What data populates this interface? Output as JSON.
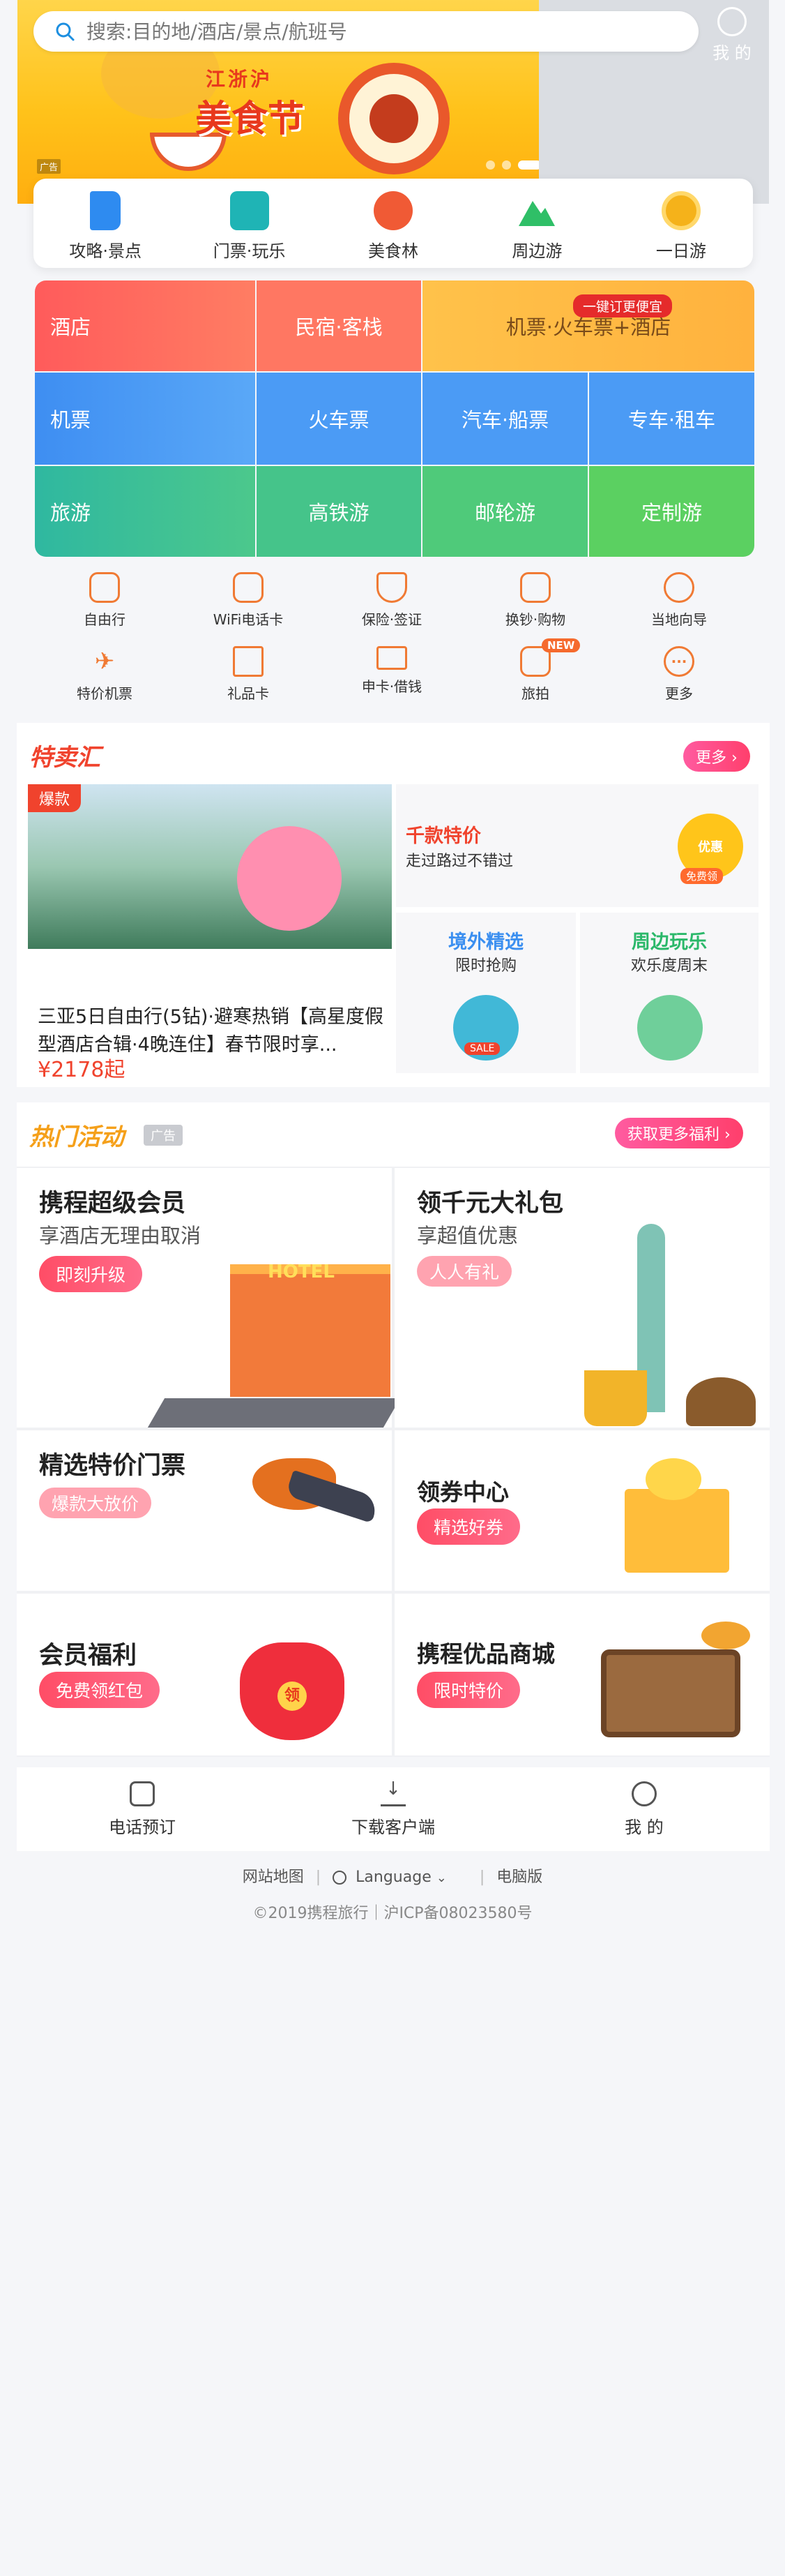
{
  "search": {
    "placeholder": "搜索:目的地/酒店/景点/航班号"
  },
  "header": {
    "mine_label": "我 的"
  },
  "banner": {
    "subtitle": "江浙沪",
    "title": "美食节",
    "ad_label": "广告",
    "slides_count": 3,
    "active_slide": 3
  },
  "quick_nav": [
    {
      "label": "攻略·景点",
      "icon": "guidebook-icon",
      "color": "#2e8bf0"
    },
    {
      "label": "门票·玩乐",
      "icon": "ticket-picture-icon",
      "color": "#1fb4b5"
    },
    {
      "label": "美食林",
      "icon": "food-badge-icon",
      "color": "#f05a35"
    },
    {
      "label": "周边游",
      "icon": "mountain-icon",
      "color": "#2fbf67"
    },
    {
      "label": "一日游",
      "icon": "sun-medal-icon",
      "color": "#f5b21a"
    }
  ],
  "grid": {
    "row1": [
      {
        "label": "酒店"
      },
      {
        "label": "民宿·客栈"
      },
      {
        "label": "机票·火车票+酒店",
        "badge": "一键订更便宜"
      }
    ],
    "row2": [
      {
        "label": "机票"
      },
      {
        "label": "火车票"
      },
      {
        "label": "汽车·船票"
      },
      {
        "label": "专车·租车"
      }
    ],
    "row3": [
      {
        "label": "旅游"
      },
      {
        "label": "高铁游"
      },
      {
        "label": "邮轮游"
      },
      {
        "label": "定制游"
      }
    ],
    "colors": {
      "hotel": "#ff6a5b",
      "flight": "#4fa3f7",
      "travel": "#42c78b",
      "combo": "#ffbd4a"
    }
  },
  "small_icons": [
    {
      "label": "自由行",
      "icon": "backpack-icon"
    },
    {
      "label": "WiFi电话卡",
      "icon": "wifi-card-icon"
    },
    {
      "label": "保险·签证",
      "icon": "shield-icon"
    },
    {
      "label": "换钞·购物",
      "icon": "shopping-bag-icon"
    },
    {
      "label": "当地向导",
      "icon": "guide-hat-icon"
    },
    {
      "label": "特价机票",
      "icon": "plane-icon"
    },
    {
      "label": "礼品卡",
      "icon": "gift-card-icon"
    },
    {
      "label": "申卡·借钱",
      "icon": "credit-card-icon"
    },
    {
      "label": "旅拍",
      "icon": "camera-play-icon",
      "badge": "NEW"
    },
    {
      "label": "更多",
      "icon": "more-dots-icon"
    }
  ],
  "special": {
    "title": "特卖汇",
    "more": "更多",
    "hot_tag": "爆款",
    "deal_text": "三亚5日自由行(5钻)·避寒热销【高星度假型酒店合辑·4晚连住】春节限时享...",
    "deal_price": "¥2178起",
    "card1": {
      "title": "千款特价",
      "subtitle": "走过路过不错过",
      "icon_text": "优惠",
      "icon_sub": "免费领"
    },
    "card2": {
      "title": "境外精选",
      "subtitle": "限时抢购",
      "icon_text": "SALE"
    },
    "card3": {
      "title": "周边玩乐",
      "subtitle": "欢乐度周末"
    }
  },
  "activities": {
    "title": "热门活动",
    "ad_label": "广告",
    "more": "获取更多福利",
    "items": [
      {
        "title": "携程超级会员",
        "subtitle": "享酒店无理由取消",
        "button": "即刻升级",
        "image_text": "HOTEL"
      },
      {
        "title": "领千元大礼包",
        "subtitle": "享超值优惠",
        "button": "人人有礼"
      },
      {
        "title": "精选特价门票",
        "button": "爆款大放价"
      },
      {
        "title": "领券中心",
        "button": "精选好券"
      },
      {
        "title": "会员福利",
        "button": "免费领红包",
        "image_text": "领"
      },
      {
        "title": "携程优品商城",
        "button": "限时特价"
      }
    ]
  },
  "footer": {
    "items": [
      {
        "label": "电话预订",
        "icon": "phone-icon"
      },
      {
        "label": "下载客户端",
        "icon": "download-icon"
      },
      {
        "label": "我 的",
        "icon": "user-icon"
      }
    ],
    "links": {
      "sitemap": "网站地图",
      "language": "Language",
      "pc": "电脑版"
    },
    "copyright": "©2019携程旅行｜沪ICP备08023580号"
  }
}
